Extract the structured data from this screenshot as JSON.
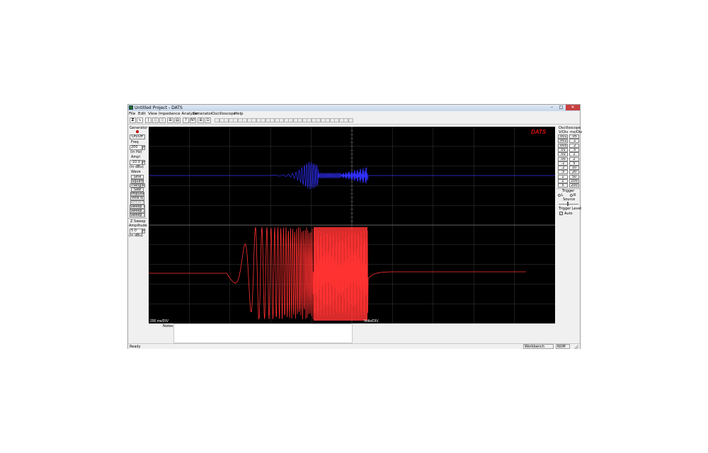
{
  "window": {
    "title": "Untitled Project - DATS",
    "controls": {
      "minimize": "–",
      "maximize": "□",
      "close": "✕"
    }
  },
  "menu": [
    "File",
    "Edit",
    "View",
    "Impedance Analyzer",
    "Generator",
    "Oscilloscope",
    "Help"
  ],
  "toolbar": {
    "buttons": [
      "Z",
      "∿",
      "|",
      "▯",
      "▯",
      "⊞",
      "▤",
      "?",
      "N?",
      "⊞",
      "⊡"
    ]
  },
  "generator": {
    "title": "Generator",
    "on_off": "On/Off",
    "freq_label": "Freq",
    "freq_value": "200",
    "freq_unit": "(in Hz)",
    "ampl_label": "Ampl",
    "ampl_value": "-10.0",
    "ampl_unit": "(in dBu)",
    "wave_label": "Wave",
    "waves": [
      "Sine",
      "Square",
      "Triangle",
      "Saw",
      "Impulse",
      "Pink N",
      "White N",
      "Sweep 1",
      "Sweep 2",
      "Sweep 3"
    ],
    "zsweep_label": "Z Sweep",
    "amplitude_label": "Amplitude",
    "zsweep_value": "5.0",
    "zsweep_unit": "(in dBu)"
  },
  "plot": {
    "logo": "DATS",
    "time_label": "200  ms/DIV",
    "volts_label": "Volts/DIV",
    "colors": {
      "channel1": "#3030ff",
      "channel2": "#ff3030",
      "grid": "#3a3a3a",
      "background": "#000000"
    }
  },
  "oscilloscope": {
    "title": "Oscilloscope",
    "vdiv_header": "V/Div",
    "msdiv_header": "ms/Div",
    "vdiv": [
      ".001",
      ".002",
      ".005",
      ".01",
      ".02",
      ".05",
      ".1",
      ".2",
      ".5",
      "1",
      "2",
      "5"
    ],
    "msdiv": [
      ".05",
      ".1",
      ".2",
      ".5",
      "1",
      "2",
      "5",
      "10",
      "20",
      "50",
      "100",
      "200"
    ],
    "trigger_title": "Trigger",
    "trigger_l": "L",
    "trigger_r": "R",
    "source_label": "Source",
    "trigger_level_label": "Trigger Level",
    "auto_label": "Auto"
  },
  "notes": {
    "label": "Notes:"
  },
  "status": {
    "ready": "Ready",
    "workbench": "Workbench",
    "num": "NUM"
  }
}
